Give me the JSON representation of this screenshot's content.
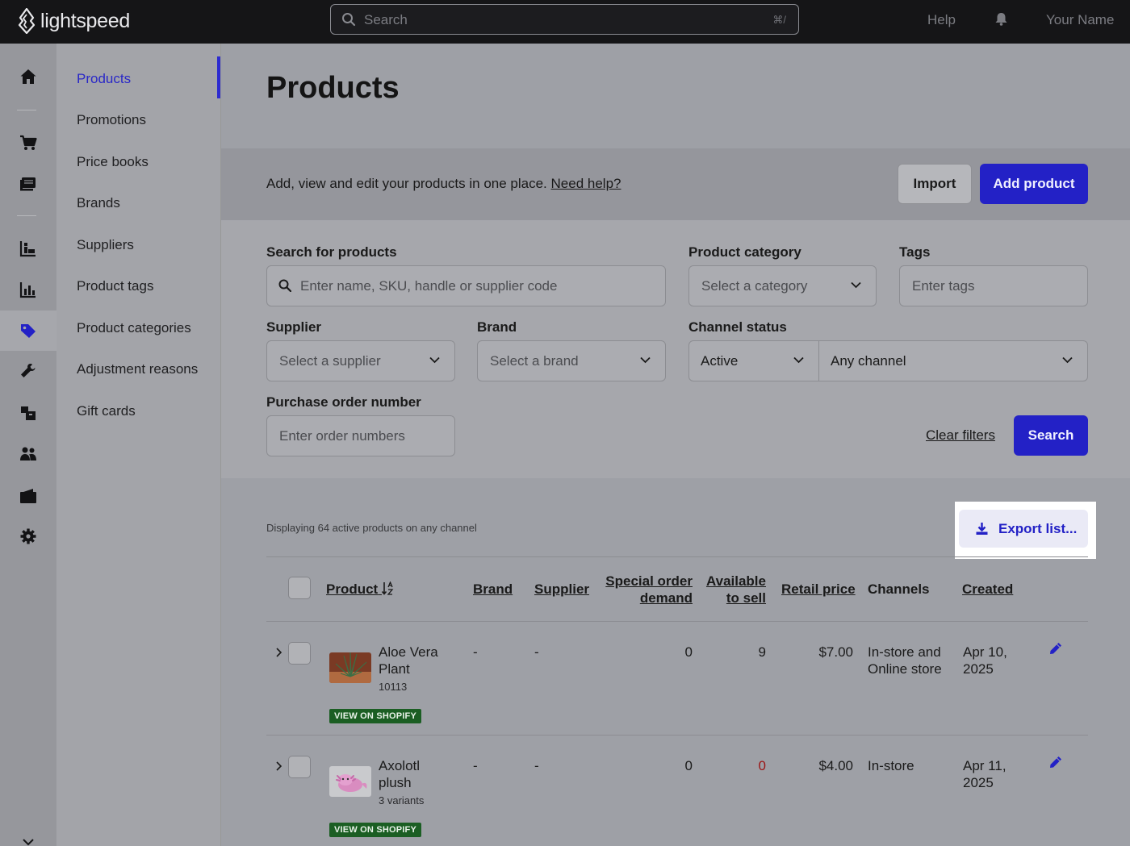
{
  "topbar": {
    "logo_text": "lightspeed",
    "search_placeholder": "Search",
    "search_shortcut": "⌘/",
    "help": "Help",
    "user_name": "Your Name"
  },
  "rail": {
    "icons": [
      "home-icon",
      "cart-icon",
      "register-icon",
      "inventory-icon",
      "reports-icon",
      "tag-icon",
      "wrench-icon",
      "boxes-icon",
      "customers-icon",
      "wallet-icon",
      "gear-icon"
    ],
    "active": "tag-icon"
  },
  "subnav": {
    "items": [
      {
        "label": "Products",
        "active": true
      },
      {
        "label": "Promotions"
      },
      {
        "label": "Price books"
      },
      {
        "label": "Brands"
      },
      {
        "label": "Suppliers"
      },
      {
        "label": "Product tags"
      },
      {
        "label": "Product categories"
      },
      {
        "label": "Adjustment reasons"
      },
      {
        "label": "Gift cards"
      }
    ]
  },
  "page": {
    "title": "Products",
    "intro": "Add, view and edit your products in one place.",
    "help_link": "Need help?",
    "import_button": "Import",
    "add_button": "Add product"
  },
  "filters": {
    "search_label": "Search for products",
    "search_placeholder": "Enter name, SKU, handle or supplier code",
    "category_label": "Product category",
    "category_placeholder": "Select a category",
    "tags_label": "Tags",
    "tags_placeholder": "Enter tags",
    "supplier_label": "Supplier",
    "supplier_placeholder": "Select a supplier",
    "brand_label": "Brand",
    "brand_placeholder": "Select a brand",
    "channel_status_label": "Channel status",
    "status_value": "Active",
    "channel_value": "Any channel",
    "po_label": "Purchase order number",
    "po_placeholder": "Enter order numbers",
    "clear": "Clear filters",
    "search_button": "Search"
  },
  "list": {
    "count_text": "Displaying 64 active products on any channel",
    "export_label": "Export list...",
    "columns": {
      "product": "Product",
      "brand": "Brand",
      "supplier": "Supplier",
      "special_1": "Special order",
      "special_2": "demand",
      "available_1": "Available",
      "available_2": "to sell",
      "retail": "Retail price",
      "channels": "Channels",
      "created": "Created"
    },
    "rows": [
      {
        "name_1": "Aloe Vera",
        "name_2": "Plant",
        "sub": "10113",
        "badge": "VIEW ON SHOPIFY",
        "brand": "-",
        "supplier": "-",
        "special": "0",
        "available": "9",
        "available_negative": false,
        "price": "$7.00",
        "channels_1": "In-store and",
        "channels_2": "Online store",
        "created_1": "Apr 10,",
        "created_2": "2025"
      },
      {
        "name_1": "Axolotl",
        "name_2": "plush",
        "sub": "3 variants",
        "badge": "VIEW ON SHOPIFY",
        "brand": "-",
        "supplier": "-",
        "special": "0",
        "available": "0",
        "available_negative": true,
        "price": "$4.00",
        "channels_1": "In-store",
        "channels_2": "",
        "created_1": "Apr 11,",
        "created_2": "2025"
      }
    ]
  },
  "colors": {
    "accent": "#2321c6",
    "badge_green": "#1b5e23",
    "warning_red": "#9b1515"
  }
}
